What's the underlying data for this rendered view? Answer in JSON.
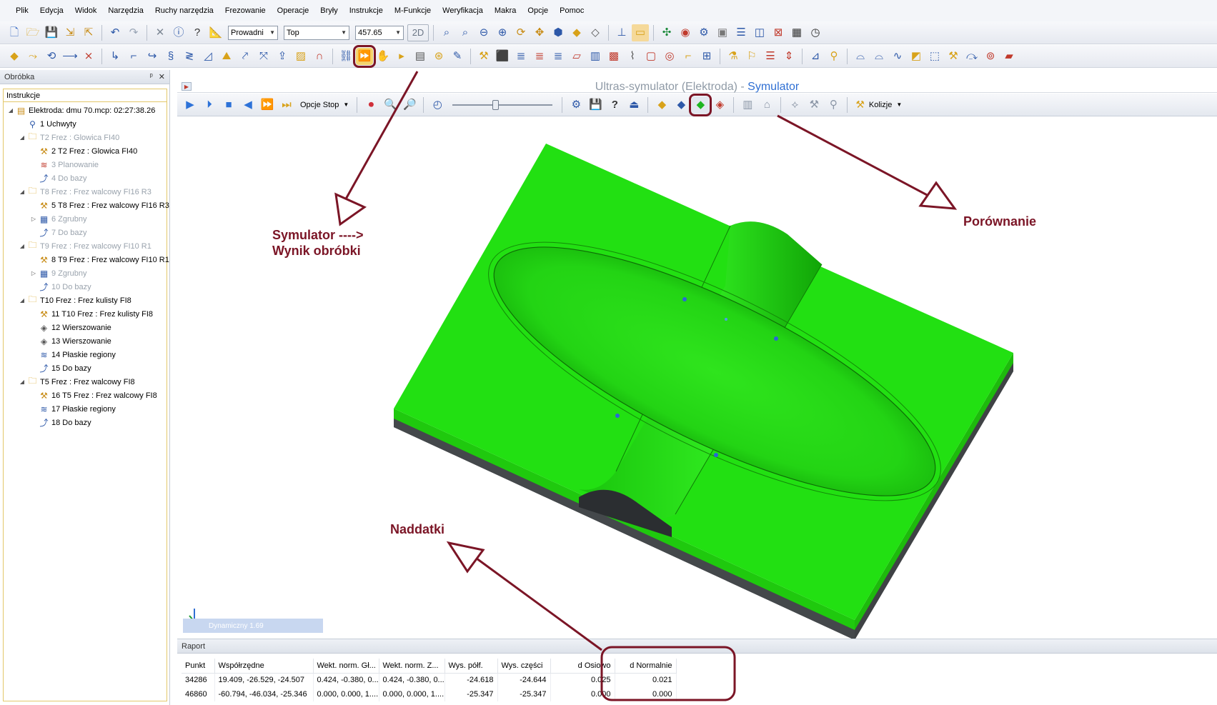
{
  "menu": [
    "Plik",
    "Edycja",
    "Widok",
    "Narzędzia",
    "Ruchy narzędzia",
    "Frezowanie",
    "Operacje",
    "Bryły",
    "Instrukcje",
    "M-Funkcje",
    "Weryfikacja",
    "Makra",
    "Opcje",
    "Pomoc"
  ],
  "toolbar": {
    "tool_combo": "Prowadni",
    "view_combo": "Top",
    "value_combo": "457.65",
    "two_d": "2D"
  },
  "left_panel": {
    "title": "Obróbka",
    "pin": "ᵖ",
    "close": "✕",
    "tree_header": "Instrukcje",
    "nodes": [
      {
        "label": "Elektroda: dmu 70.mcp: 02:27:38.26",
        "level": 0,
        "toggle": "◢",
        "icon": "nc-file-icon",
        "glyph": "▤",
        "dim": false
      },
      {
        "label": "1 Uchwyty",
        "level": 1,
        "toggle": "",
        "icon": "fixture-icon",
        "glyph": "⚲",
        "dim": false
      },
      {
        "label": "T2 Frez : Glowica FI40",
        "level": 1,
        "toggle": "◢",
        "icon": "folder-icon",
        "glyph": "🗀",
        "dim": true
      },
      {
        "label": "2 T2 Frez : Glowica FI40",
        "level": 2,
        "toggle": "",
        "icon": "tool-icon",
        "glyph": "⚒",
        "dim": false
      },
      {
        "label": "3 Planowanie",
        "level": 2,
        "toggle": "",
        "icon": "facing-icon",
        "glyph": "≋",
        "dim": true
      },
      {
        "label": "4 Do bazy",
        "level": 2,
        "toggle": "",
        "icon": "home-move-icon",
        "glyph": "⤴",
        "dim": true
      },
      {
        "label": "T8 Frez : Frez walcowy FI16 R3",
        "level": 1,
        "toggle": "◢",
        "icon": "folder-icon",
        "glyph": "🗀",
        "dim": true
      },
      {
        "label": "5 T8 Frez : Frez walcowy FI16 R3",
        "level": 2,
        "toggle": "",
        "icon": "tool-icon",
        "glyph": "⚒",
        "dim": false
      },
      {
        "label": "6 Zgrubny",
        "level": 2,
        "toggle": "▷",
        "icon": "roughing-icon",
        "glyph": "▦",
        "dim": true
      },
      {
        "label": "7 Do bazy",
        "level": 2,
        "toggle": "",
        "icon": "home-move-icon",
        "glyph": "⤴",
        "dim": true
      },
      {
        "label": "T9 Frez : Frez walcowy FI10 R1",
        "level": 1,
        "toggle": "◢",
        "icon": "folder-icon",
        "glyph": "🗀",
        "dim": true
      },
      {
        "label": "8 T9 Frez : Frez walcowy FI10 R1",
        "level": 2,
        "toggle": "",
        "icon": "tool-icon",
        "glyph": "⚒",
        "dim": false
      },
      {
        "label": "9 Zgrubny",
        "level": 2,
        "toggle": "▷",
        "icon": "roughing-icon",
        "glyph": "▦",
        "dim": true
      },
      {
        "label": "10 Do bazy",
        "level": 2,
        "toggle": "",
        "icon": "home-move-icon",
        "glyph": "⤴",
        "dim": true
      },
      {
        "label": "T10 Frez : Frez kulisty FI8",
        "level": 1,
        "toggle": "◢",
        "icon": "folder-icon",
        "glyph": "🗀",
        "dim": false
      },
      {
        "label": "11 T10 Frez : Frez kulisty FI8",
        "level": 2,
        "toggle": "",
        "icon": "tool-icon",
        "glyph": "⚒",
        "dim": false
      },
      {
        "label": "12 Wierszowanie",
        "level": 2,
        "toggle": "",
        "icon": "raster-icon",
        "glyph": "◈",
        "dim": false
      },
      {
        "label": "13 Wierszowanie",
        "level": 2,
        "toggle": "",
        "icon": "raster-icon",
        "glyph": "◈",
        "dim": false
      },
      {
        "label": "14 Płaskie regiony",
        "level": 2,
        "toggle": "",
        "icon": "flat-regions-icon",
        "glyph": "≋",
        "dim": false
      },
      {
        "label": "15 Do bazy",
        "level": 2,
        "toggle": "",
        "icon": "home-move-icon",
        "glyph": "⤴",
        "dim": false
      },
      {
        "label": "T5 Frez : Frez walcowy FI8",
        "level": 1,
        "toggle": "◢",
        "icon": "folder-icon",
        "glyph": "🗀",
        "dim": false
      },
      {
        "label": "16 T5 Frez : Frez walcowy FI8",
        "level": 2,
        "toggle": "",
        "icon": "tool-icon",
        "glyph": "⚒",
        "dim": false
      },
      {
        "label": "17 Płaskie regiony",
        "level": 2,
        "toggle": "",
        "icon": "flat-regions-icon",
        "glyph": "≋",
        "dim": false
      },
      {
        "label": "18 Do bazy",
        "level": 2,
        "toggle": "",
        "icon": "home-move-icon",
        "glyph": "⤴",
        "dim": false
      }
    ]
  },
  "simulator": {
    "title_main": "Ultras-symulator (Elektroda) - ",
    "title_accent": "Symulator",
    "stop_options": "Opcje Stop",
    "collisions": "Kolizje",
    "status": "Dynamiczny 1.69"
  },
  "report": {
    "title": "Raport",
    "columns": [
      "Punkt",
      "Współrzędne",
      "Wekt. norm. Gł...",
      "Wekt. norm. Z...",
      "Wys. półf.",
      "Wys. części",
      "d Osiowo",
      "d Normalnie"
    ],
    "rows": [
      [
        "34286",
        "19.409, -26.529, -24.507",
        "0.424, -0.380, 0...",
        "0.424, -0.380, 0...",
        "-24.618",
        "-24.644",
        "0.025",
        "0.021"
      ],
      [
        "46860",
        "-60.794, -46.034, -25.346",
        "0.000, 0.000, 1....",
        "0.000, 0.000, 1....",
        "-25.347",
        "-25.347",
        "0.000",
        "0.000"
      ]
    ]
  },
  "annotations": {
    "sim_line1": "Symulator ---->",
    "sim_line2": "Wynik obróbki",
    "compare": "Porównanie",
    "allowance": "Naddatki"
  },
  "colors": {
    "part_green": "#22e012",
    "part_side": "#1dbb0c",
    "base_dark": "#3f4245",
    "annotation": "#7b1526",
    "title_accent": "#2f6fd3"
  }
}
